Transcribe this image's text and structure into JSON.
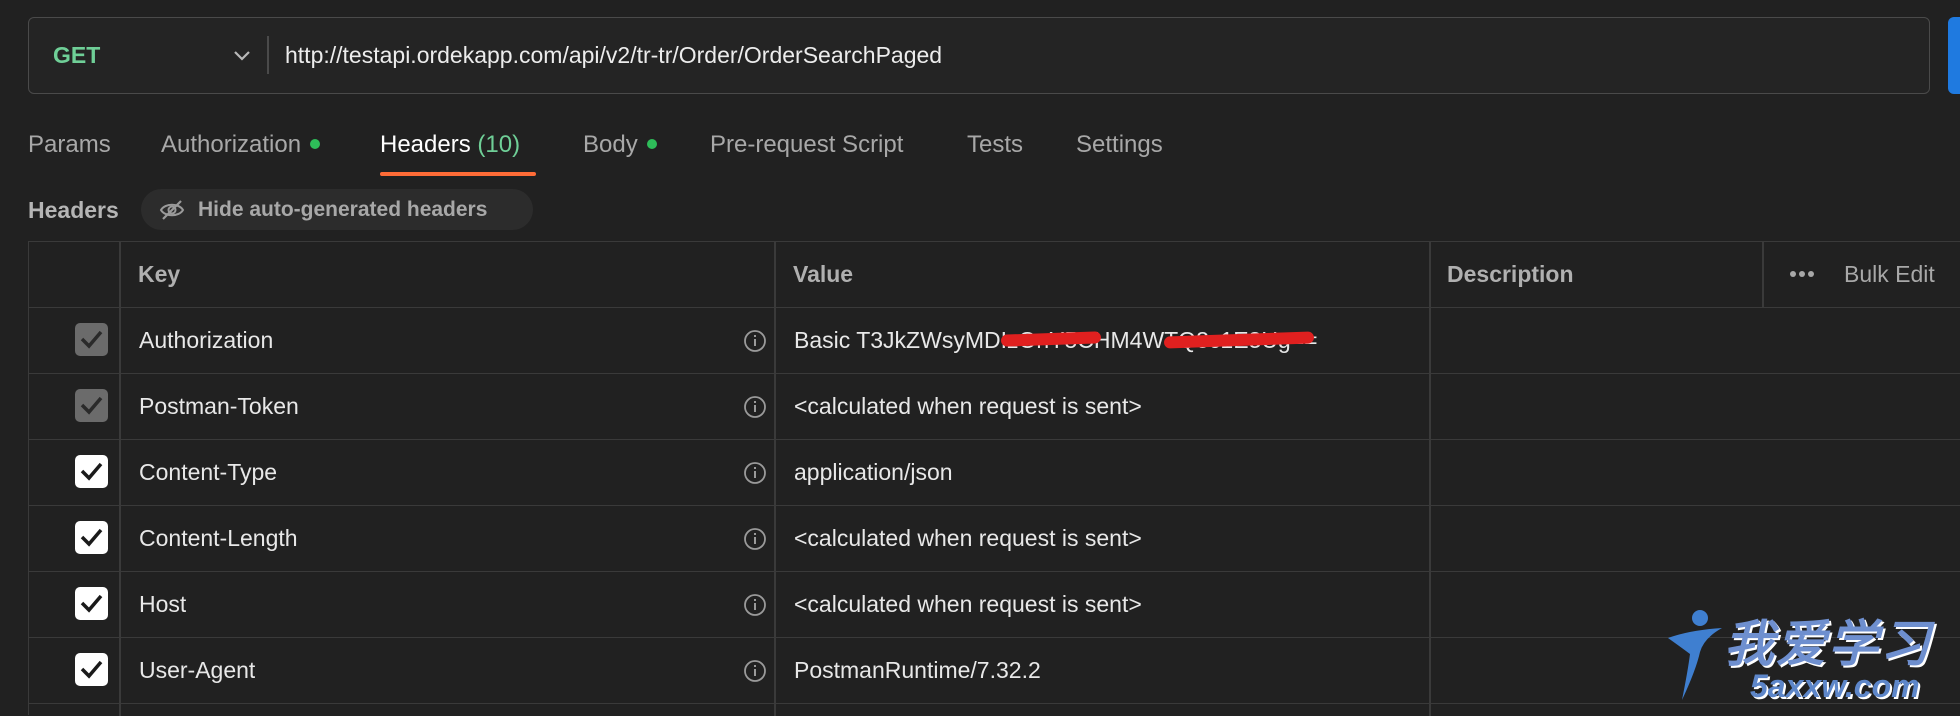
{
  "request": {
    "method": "GET",
    "url": "http://testapi.ordekapp.com/api/v2/tr-tr/Order/OrderSearchPaged"
  },
  "tabs": [
    {
      "label": "Params"
    },
    {
      "label": "Authorization",
      "dot": true
    },
    {
      "label": "Headers",
      "count": "(10)",
      "active": true
    },
    {
      "label": "Body",
      "dot": true
    },
    {
      "label": "Pre-request Script"
    },
    {
      "label": "Tests"
    },
    {
      "label": "Settings"
    }
  ],
  "headers_section": {
    "label": "Headers",
    "hide_button": "Hide auto-generated headers"
  },
  "table": {
    "columns": {
      "key": "Key",
      "value": "Value",
      "description": "Description",
      "bulk_edit": "Bulk Edit"
    },
    "rows": [
      {
        "key": "Authorization",
        "value": "Basic T3JkZWsyMDIzOnY5CHM4WTQ3c1E3Ug==",
        "checked": true,
        "disabled": true
      },
      {
        "key": "Postman-Token",
        "value": "<calculated when request is sent>",
        "checked": true,
        "disabled": true
      },
      {
        "key": "Content-Type",
        "value": "application/json",
        "checked": true,
        "disabled": false
      },
      {
        "key": "Content-Length",
        "value": "<calculated when request is sent>",
        "checked": true,
        "disabled": false
      },
      {
        "key": "Host",
        "value": "<calculated when request is sent>",
        "checked": true,
        "disabled": false
      },
      {
        "key": "User-Agent",
        "value": "PostmanRuntime/7.32.2",
        "checked": true,
        "disabled": false
      }
    ]
  },
  "watermark": {
    "text": "我爱学习",
    "sub": "5axxw.com"
  },
  "colors": {
    "accent": "#ff6c37",
    "method": "#6fcf97",
    "dot": "#2ebd59",
    "send": "#1f7ae0",
    "redaction": "#e0201f"
  }
}
